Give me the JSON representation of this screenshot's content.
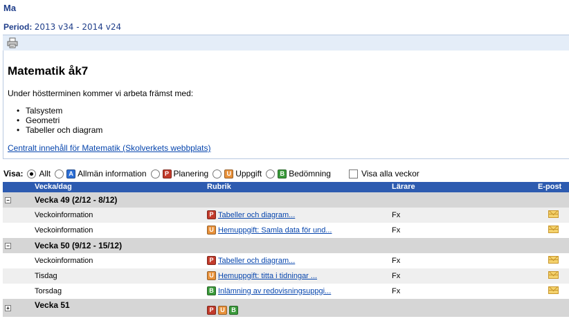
{
  "header": {
    "subject": "Ma",
    "period_label": "Period:",
    "period_value": "2013 v34 - 2014 v24"
  },
  "plan": {
    "title": "Matematik åk7",
    "intro": "Under höstterminen kommer vi arbeta främst med:",
    "items": [
      "Talsystem",
      "Geometri",
      "Tabeller och diagram"
    ],
    "link": "Centralt innehåll för Matematik (Skolverkets webbplats)"
  },
  "filters": {
    "label": "Visa:",
    "options": [
      {
        "label": "Allt",
        "selected": true
      },
      {
        "label": "Allmän information",
        "badge": "A",
        "color": "#2d6fd6"
      },
      {
        "label": "Planering",
        "badge": "P",
        "color": "#c23a2a"
      },
      {
        "label": "Uppgift",
        "badge": "U",
        "color": "#e8913a"
      },
      {
        "label": "Bedömning",
        "badge": "B",
        "color": "#3a9a3a"
      }
    ],
    "show_all_weeks": "Visa alla veckor"
  },
  "table": {
    "headers": {
      "week_day": "Vecka/dag",
      "subject": "Rubrik",
      "teacher": "Lärare",
      "email": "E-post"
    },
    "weeks": [
      {
        "label": "Vecka 49 (2/12 - 8/12)",
        "expanded": true,
        "rows": [
          {
            "day": "Veckoinformation",
            "badge": "P",
            "title": "Tabeller och diagram...",
            "teacher": "Fx"
          },
          {
            "day": "Veckoinformation",
            "badge": "U",
            "title": "Hemuppgift: Samla data för und...",
            "teacher": "Fx"
          }
        ]
      },
      {
        "label": "Vecka 50 (9/12 - 15/12)",
        "expanded": true,
        "rows": [
          {
            "day": "Veckoinformation",
            "badge": "P",
            "title": "Tabeller och diagram...",
            "teacher": "Fx"
          },
          {
            "day": "Tisdag",
            "badge": "U",
            "title": "Hemuppgift: titta i tidningar ...",
            "teacher": "Fx"
          },
          {
            "day": "Torsdag",
            "badge": "B",
            "title": "Inlämning av redovisningsuppgi...",
            "teacher": "Fx"
          }
        ]
      },
      {
        "label": "Vecka 51",
        "expanded": false,
        "badges": [
          "P",
          "U",
          "B"
        ]
      }
    ]
  },
  "badge_colors": {
    "A": "#2d6fd6",
    "P": "#c23a2a",
    "U": "#e8913a",
    "B": "#3a9a3a"
  },
  "icons": {
    "print": "printer-icon",
    "email": "envelope-icon",
    "toggle_expanded": "minus",
    "toggle_collapsed": "plus"
  }
}
